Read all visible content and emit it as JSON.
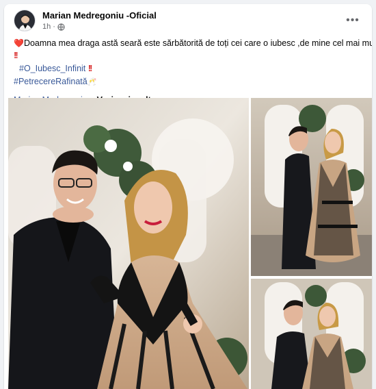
{
  "post": {
    "author": "Marian Medregoniu -Oficial",
    "time": "1h",
    "separator": "·",
    "more_icon": "more-horizontal-icon",
    "text_line1": "Doamna mea draga astă seară este sărbătorită de toți cei care o iubesc ,de mine cel mai mult",
    "heart": "❤️",
    "double_exclaim": "!!",
    "hashtag1": "#O_Iubesc_Infinit",
    "hashtag2": "#PetrecereRafinată",
    "cheers": "🥂",
    "author_link": "Marian Medregoniu",
    "ellipsis": "...",
    "see_more": "Vezi mai mult"
  },
  "colors": {
    "link": "#385898",
    "meta": "#65676b",
    "accent_red": "#d92b2b"
  },
  "photos": [
    {
      "name": "post-photo-main",
      "icon": "couple-photo"
    },
    {
      "name": "post-photo-top-right",
      "icon": "couple-photo"
    },
    {
      "name": "post-photo-bottom-right",
      "icon": "couple-photo"
    }
  ]
}
